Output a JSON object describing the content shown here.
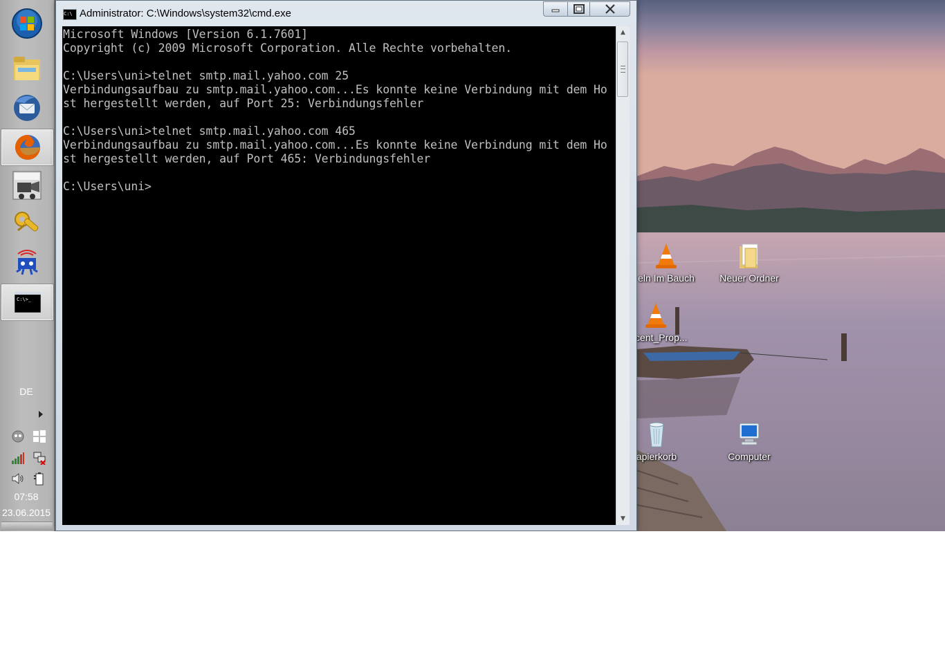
{
  "window": {
    "title": "Administrator: C:\\Windows\\system32\\cmd.exe"
  },
  "console": {
    "lines": [
      "Microsoft Windows [Version 6.1.7601]",
      "Copyright (c) 2009 Microsoft Corporation. Alle Rechte vorbehalten.",
      "",
      "C:\\Users\\uni>telnet smtp.mail.yahoo.com 25",
      "Verbindungsaufbau zu smtp.mail.yahoo.com...Es konnte keine Verbindung mit dem Ho",
      "st hergestellt werden, auf Port 25: Verbindungsfehler",
      "",
      "C:\\Users\\uni>telnet smtp.mail.yahoo.com 465",
      "Verbindungsaufbau zu smtp.mail.yahoo.com...Es konnte keine Verbindung mit dem Ho",
      "st hergestellt werden, auf Port 465: Verbindungsfehler",
      "",
      "C:\\Users\\uni>"
    ]
  },
  "taskbar": {
    "items": [
      {
        "icon": "start-orb-icon"
      },
      {
        "icon": "explorer-folder-icon"
      },
      {
        "icon": "thunderbird-icon"
      },
      {
        "icon": "firefox-icon"
      },
      {
        "icon": "movie-maker-icon"
      },
      {
        "icon": "tools-icon"
      },
      {
        "icon": "network-monitor-icon"
      },
      {
        "icon": "cmd-icon"
      }
    ],
    "language": "DE",
    "clock_time": "07:58",
    "clock_date": "23.06.2015"
  },
  "desktop": {
    "icons": [
      {
        "label": "eln Im Bauch",
        "icon": "vlc-cone-icon"
      },
      {
        "label": "Neuer Ordner",
        "icon": "folder-icon"
      },
      {
        "label": "decent_Prop...",
        "icon": "vlc-cone-icon"
      },
      {
        "label": "apierkorb",
        "icon": "recycle-bin-icon"
      },
      {
        "label": "Computer",
        "icon": "computer-icon"
      }
    ]
  }
}
